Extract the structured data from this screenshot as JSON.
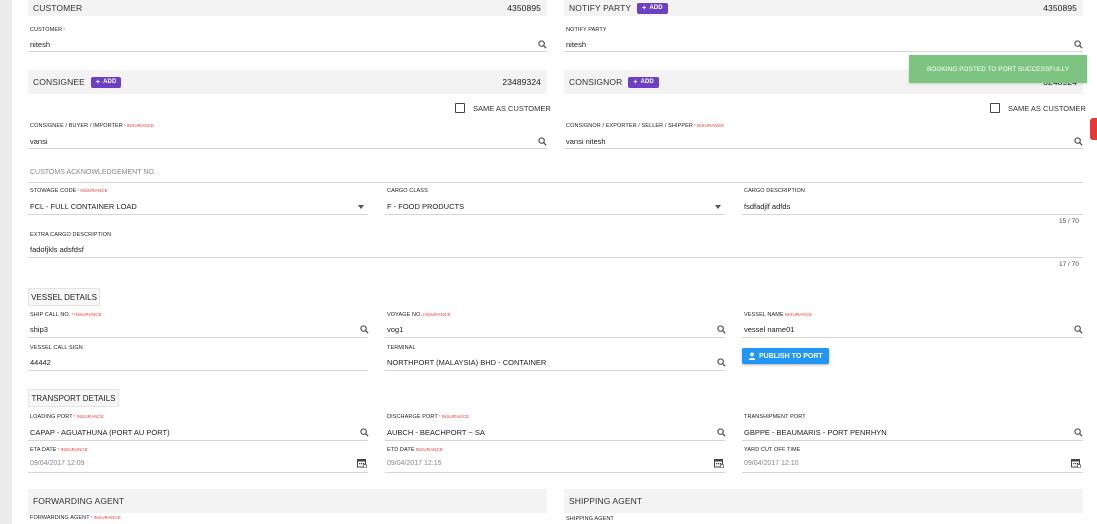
{
  "customer": {
    "title": "CUSTOMER",
    "number": "4350895",
    "field_label": "CUSTOMER",
    "req_mark": "*",
    "value": "nitesh"
  },
  "notify": {
    "title": "NOTIFY PARTY",
    "add_label": "ADD",
    "number": "4350895",
    "field_label": "NOTIFY PARTY",
    "value": "nitesh"
  },
  "consignee": {
    "title": "CONSIGNEE",
    "add_label": "ADD",
    "number": "23489324",
    "same_as_label": "SAME AS CUSTOMER",
    "field_label": "CONSIGNEE / BUYER / IMPORTER",
    "req_mark": "*",
    "insurance": "INSURANCE",
    "value": "vansi"
  },
  "consignor": {
    "title": "CONSIGNOR",
    "add_label": "ADD",
    "number": "3248924",
    "same_as_label": "SAME AS CUSTOMER",
    "field_label": "CONSIGNOR / EXPORTER / SELLER / SHIPPER",
    "req_mark": "*",
    "insurance": "INSURANCE",
    "value": "vansi nitesh"
  },
  "toast": {
    "message": "BOOKING POSTED TO PORT SUCCESSFULLY"
  },
  "customs": {
    "placeholder": "CUSTOMS ACKNOWLEDGEMENT NO."
  },
  "cargo": {
    "stowage_label": "STOWAGE CODE",
    "stowage_req": "*",
    "stowage_ins": "INSURANCE",
    "stowage_value": "FCL - FULL CONTAINER LOAD",
    "class_label": "CARGO CLASS",
    "class_value": "F - FOOD PRODUCTS",
    "desc_label": "CARGO DESCRIPTION",
    "desc_value": "fsdfadjlf adfds",
    "desc_counter": "15 / 70",
    "extra_label": "EXTRA CARGO DESCRIPTION",
    "extra_value": "fadofjkls adsfdsf",
    "extra_counter": "17 / 70"
  },
  "vessel": {
    "heading": "VESSEL DETAILS",
    "ship_call_label": "SHIP CALL NO.",
    "ship_call_req": "*",
    "ship_call_ins": "INSURANCE",
    "ship_call_value": "ship3",
    "voyage_label": "VOYAGE NO.",
    "voyage_ins": "INSURANCE",
    "voyage_value": "vog1",
    "name_label": "VESSEL NAME",
    "name_ins": "INSURANCE",
    "name_value": "vessel name01",
    "call_sign_label": "VESSEL CALL SIGN",
    "call_sign_value": "44442",
    "terminal_label": "TERMINAL",
    "terminal_value": "NORTHPORT (MALAYSIA) BHD - CONTAINER",
    "publish_label": "PUBLISH TO PORT"
  },
  "transport": {
    "heading": "TRANSPORT DETAILS",
    "loading_label": "LOADING PORT",
    "loading_req": "*",
    "loading_ins": "INSURANCE",
    "loading_value": "CAPAP - AGUATHUNA (PORT AU PORT)",
    "discharge_label": "DISCHARGE PORT",
    "discharge_req": "*",
    "discharge_ins": "INSURANCE",
    "discharge_value": "AUBCH - BEACHPORT ~ SA",
    "tranship_label": "TRANSHIPMENT PORT",
    "tranship_value": "GBPPE - BEAUMARIS - PORT PENRHYN",
    "eta_label": "ETA DATE",
    "eta_req": "*",
    "eta_ins": "INSURANCE",
    "eta_value": "09/04/2017 12:09",
    "etd_label": "ETD DATE",
    "etd_ins": "INSURANCE",
    "etd_value": "09/04/2017 12:15",
    "cutoff_label": "YARD CUT OFF TIME",
    "cutoff_value": "09/04/2017 12:10"
  },
  "forwarding": {
    "title": "FORWARDING AGENT",
    "field_label": "FORWARDING AGENT",
    "req_mark": "*",
    "insurance": "INSURANCE"
  },
  "shipping": {
    "title": "SHIPPING AGENT",
    "field_label": "SHIPPING AGENT"
  },
  "colors": {
    "accent_purple": "#6d3fc2",
    "publish_blue": "#2196f3",
    "toast_green": "#7dc482",
    "required_red": "#e53935"
  },
  "icons": {
    "search": "search-icon",
    "calendar": "calendar-icon",
    "dropdown": "caret-down-icon",
    "user": "user-icon"
  }
}
